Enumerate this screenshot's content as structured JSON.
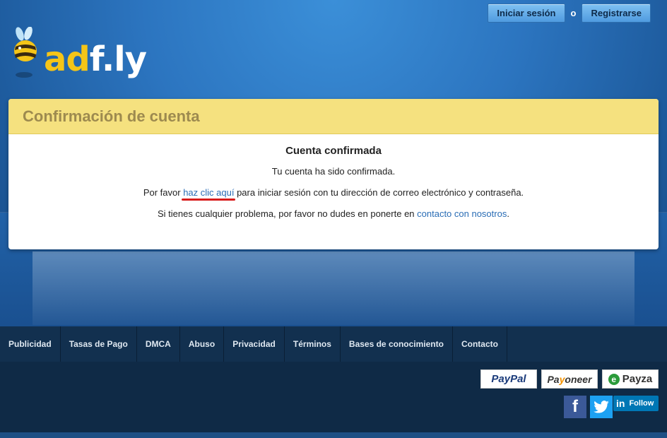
{
  "header": {
    "login_label": "Iniciar sesión",
    "or_label": "o",
    "register_label": "Registrarse",
    "logo_ad": "ad",
    "logo_fly": "f.ly"
  },
  "panel": {
    "title": "Confirmación de cuenta",
    "heading": "Cuenta confirmada",
    "line1": "Tu cuenta ha sido confirmada.",
    "line2_before": "Por favor ",
    "line2_link": "haz clic aquí",
    "line2_after": " para iniciar sesión con tu dirección de correo electrónico y contraseña.",
    "line3_before": "Si tienes cualquier problema, por favor no dudes en ponerte en ",
    "line3_link": "contacto con nosotros",
    "line3_after": "."
  },
  "footer": {
    "nav": [
      {
        "label": "Publicidad"
      },
      {
        "label": "Tasas de Pago"
      },
      {
        "label": "DMCA"
      },
      {
        "label": "Abuso"
      },
      {
        "label": "Privacidad"
      },
      {
        "label": "Términos"
      },
      {
        "label": "Bases de conocimiento"
      },
      {
        "label": "Contacto"
      }
    ],
    "payments": {
      "paypal": "PayPal",
      "payoneer_a": "Pa",
      "payoneer_o": "y",
      "payoneer_b": "oneer",
      "payza": "Payza"
    },
    "social": {
      "facebook_glyph": "f",
      "linkedin_glyph": "in",
      "linkedin_follow": "Follow"
    }
  },
  "colors": {
    "accent_yellow": "#f5e17f",
    "link_blue": "#2a6db5",
    "underline_red": "#d81b1b"
  }
}
